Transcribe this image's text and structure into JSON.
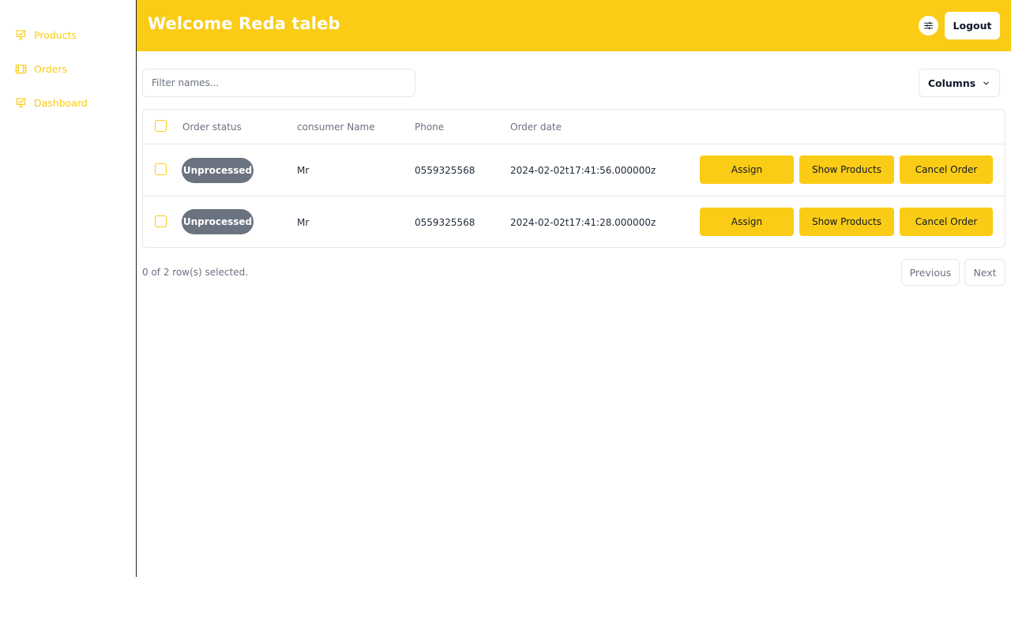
{
  "sidebar": {
    "items": [
      {
        "label": "Products",
        "icon": "presentation-chart-icon"
      },
      {
        "label": "Orders",
        "icon": "film-icon"
      },
      {
        "label": "Dashboard",
        "icon": "presentation-chart-icon"
      }
    ]
  },
  "header": {
    "title": "Welcome Reda taleb",
    "settings_icon": "sliders-icon",
    "logout_label": "Logout"
  },
  "toolbar": {
    "filter_placeholder": "Filter names...",
    "filter_value": "",
    "columns_label": "Columns"
  },
  "table": {
    "headers": [
      "Order status",
      "consumer Name",
      "Phone",
      "Order date"
    ],
    "rows": [
      {
        "status": "Unprocessed",
        "consumer": "Mr",
        "phone": "0559325568",
        "date": "2024-02-02t17:41:56.000000z",
        "actions": [
          "Assign",
          "Show Products",
          "Cancel Order"
        ]
      },
      {
        "status": "Unprocessed",
        "consumer": "Mr",
        "phone": "0559325568",
        "date": "2024-02-02t17:41:28.000000z",
        "actions": [
          "Assign",
          "Show Products",
          "Cancel Order"
        ]
      }
    ]
  },
  "footer": {
    "selection_text": "0 of 2 row(s) selected.",
    "previous_label": "Previous",
    "next_label": "Next"
  },
  "colors": {
    "accent": "#facc15",
    "badge": "#6b7280",
    "border": "#e5e7eb"
  }
}
